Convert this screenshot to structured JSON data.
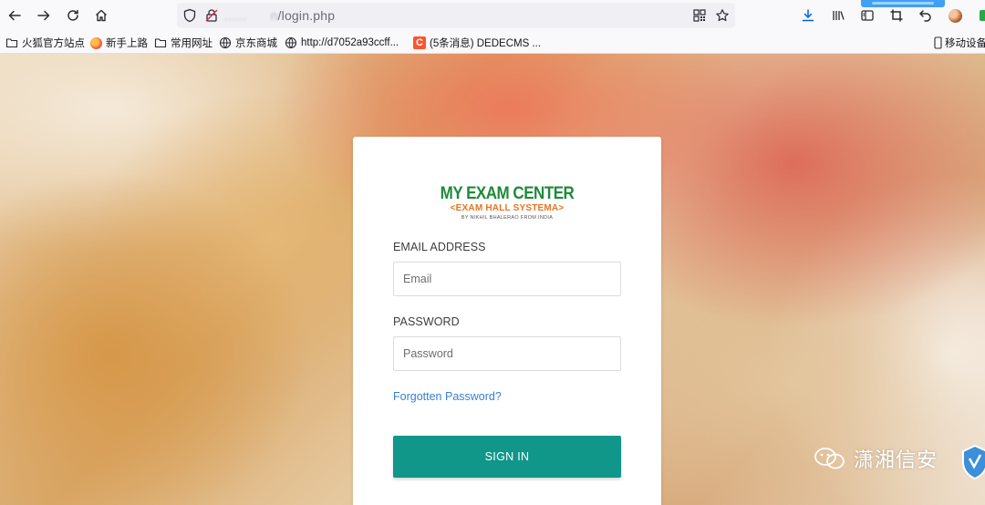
{
  "browser": {
    "url_masked": "......",
    "url_mid": "n",
    "url_path": "/login.php"
  },
  "bookmarks": [
    {
      "label": "火狐官方站点",
      "icon": "folder-icon"
    },
    {
      "label": "新手上路",
      "icon": "firefox-icon"
    },
    {
      "label": "常用网址",
      "icon": "folder-icon"
    },
    {
      "label": "京东商城",
      "icon": "globe-icon"
    },
    {
      "label": "http://d7052a93ccff...",
      "icon": "globe-icon"
    },
    {
      "label": "(5条消息) DEDECMS ...",
      "icon": "csdn-icon"
    }
  ],
  "mobile_bookmarks": "移动设备",
  "logo": {
    "line1": "MY EXAM CENTER",
    "line2": "<EXAM HALL SYSTEMA>",
    "line3": "BY NIKHIL BHALERAO FROM INDIA"
  },
  "form": {
    "email_label": "EMAIL ADDRESS",
    "email_placeholder": "Email",
    "password_label": "PASSWORD",
    "password_placeholder": "Password",
    "forgot_link": "Forgotten Password?",
    "signin_label": "SIGN IN"
  },
  "csdn_glyph": "C",
  "watermark": "潇湘信安",
  "colors": {
    "signin_button": "#11968a",
    "link": "#3a7fcf",
    "logo_green": "#1f8a3a",
    "logo_orange": "#e8741f"
  }
}
